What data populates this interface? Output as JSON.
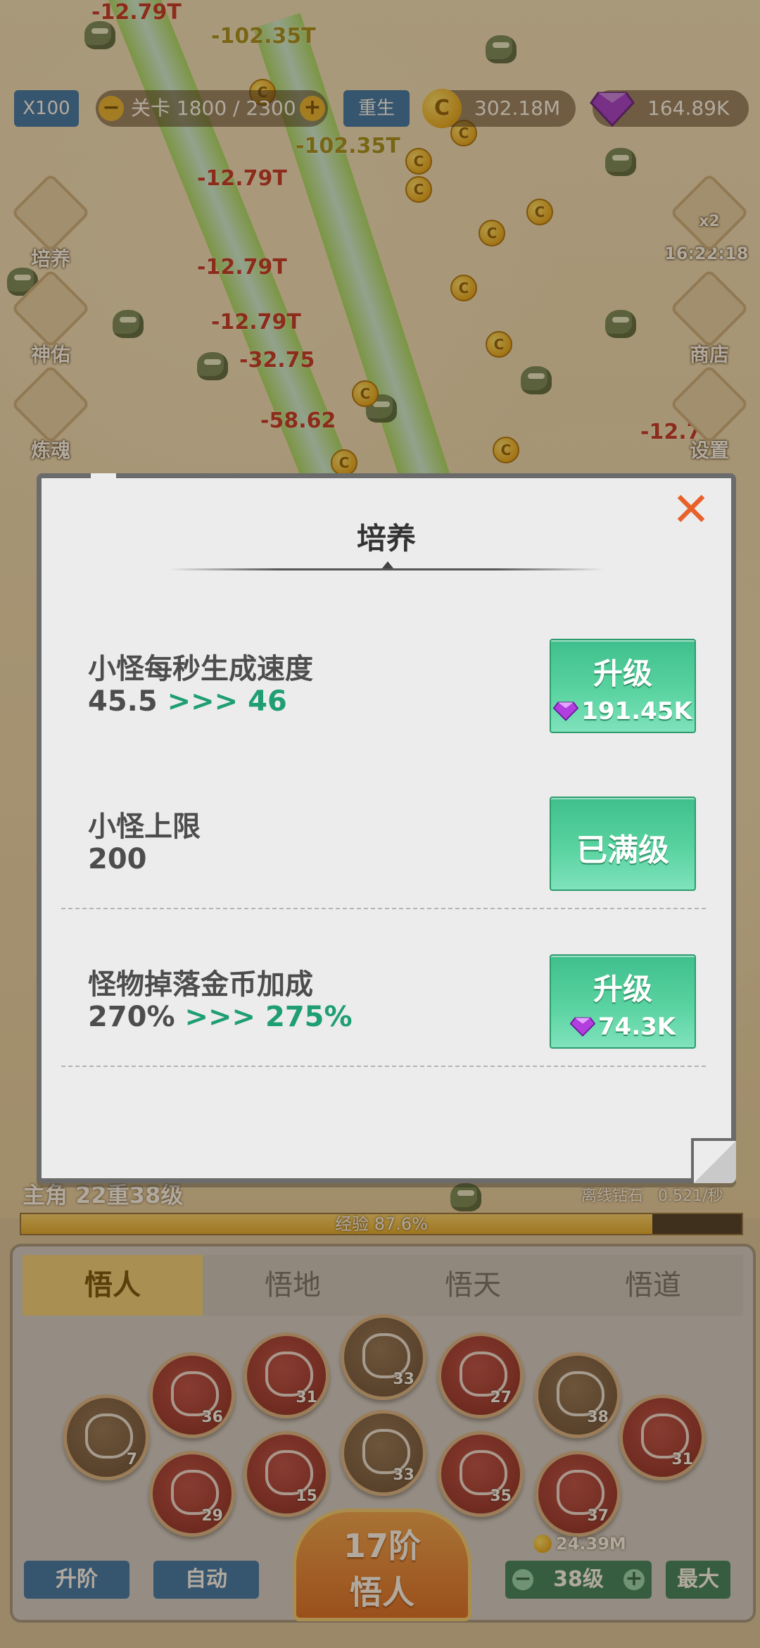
{
  "hud": {
    "speed": "X100",
    "stage": "关卡 1800 / 2300",
    "rebirth": "重生",
    "coins": "302.18M",
    "gems": "164.89K",
    "boost_label": "x2",
    "boost_timer": "16:22:18"
  },
  "side_left": [
    "培养",
    "神佑",
    "炼魂"
  ],
  "side_right": [
    "商店",
    "设置"
  ],
  "damage_texts": [
    "-12.79T",
    "-102.35T",
    "-102.35T",
    "-12.79T",
    "-12.79T",
    "-12.79T",
    "-32.75",
    "-58.62",
    "-12.7"
  ],
  "player": {
    "rank": "主角 22重38级",
    "exp_label": "经验 87.6%",
    "exp_progress": 0.876,
    "offline_label": "离线钻石",
    "offline_rate": "0.521/秒"
  },
  "bottom": {
    "tabs": [
      "悟人",
      "悟地",
      "悟天",
      "悟道"
    ],
    "active_tab": 0,
    "zodiac_levels": [
      "7",
      "36",
      "29",
      "31",
      "15",
      "33",
      "33",
      "27",
      "35",
      "38",
      "37",
      "31"
    ],
    "advance_button": "升阶",
    "auto_button": "自动",
    "center_button_line1": "17阶",
    "center_button_line2": "悟人",
    "cost": "24.39M",
    "level": "38级",
    "max_button": "最大"
  },
  "dialog": {
    "title": "培养",
    "rows": [
      {
        "name": "小怪每秒生成速度",
        "current": "45.5",
        "arrow": ">>>",
        "next": "46",
        "button": "升级",
        "cost": "191.45K"
      },
      {
        "name": "小怪上限",
        "current": "200",
        "arrow": "",
        "next": "",
        "button": "已满级",
        "cost": ""
      },
      {
        "name": "怪物掉落金币加成",
        "current": "270%",
        "arrow": ">>>",
        "next": "275%",
        "button": "升级",
        "cost": "74.3K"
      }
    ]
  },
  "colors": {
    "accent_green": "#1f9e74",
    "button_green": "#4cc995",
    "close_orange": "#e8612b",
    "hud_blue": "#2b6fae"
  }
}
